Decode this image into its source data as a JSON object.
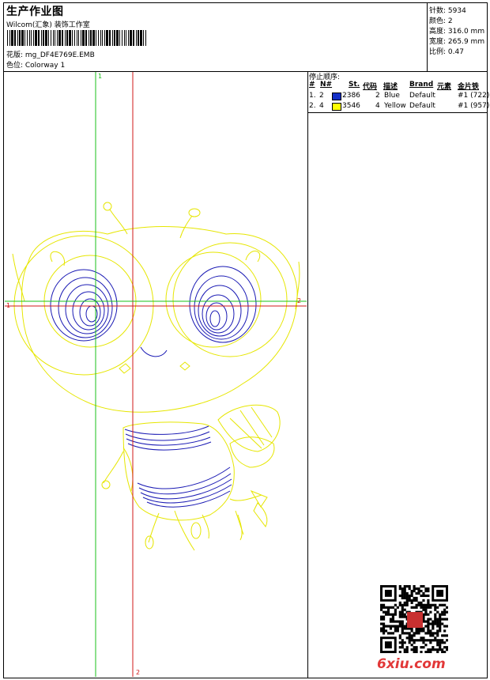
{
  "header": {
    "title": "生产作业图",
    "company": "Wilcom(汇象) 装饰工作室",
    "pattern_line": "花版: mg_DF4E769E.EMB",
    "colorway_line": "色位: Colorway 1"
  },
  "stats": [
    {
      "label": "针数",
      "value": "5934"
    },
    {
      "label": "颜色",
      "value": "2"
    },
    {
      "label": "高度",
      "value": "316.0 mm"
    },
    {
      "label": "宽度",
      "value": "265.9 mm"
    },
    {
      "label": "比例",
      "value": "0.47"
    }
  ],
  "stop_sequence": {
    "title": "停止顺序:",
    "headers": {
      "num": "#",
      "n": "N#",
      "st": "St.",
      "code": "代码",
      "desc": "描述",
      "brand": "Brand",
      "elem": "元素",
      "sequin": "金片铁"
    },
    "rows": [
      {
        "num": "1.",
        "n": "2",
        "color": "#1430c8",
        "st": "2386",
        "code": "2",
        "desc": "Blue",
        "brand": "Default",
        "sequin": "#1 (722)"
      },
      {
        "num": "2.",
        "n": "4",
        "color": "#ffff00",
        "st": "3546",
        "code": "4",
        "desc": "Yellow",
        "brand": "Default",
        "sequin": "#1 (957)"
      }
    ]
  },
  "guides": {
    "v1": "1",
    "v2": "2",
    "h1": "1",
    "h2": "2"
  },
  "colors": {
    "yellow": "#e6e600",
    "blue": "#1a1ab4",
    "green_guide": "#18c018",
    "red_guide": "#d01818"
  },
  "watermark": "6xiu.com"
}
